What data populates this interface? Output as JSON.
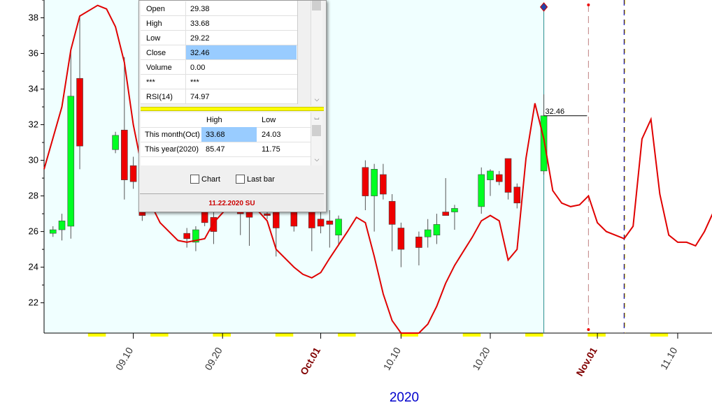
{
  "chart_data": {
    "type": "candlestick",
    "year_label": "2020",
    "y_ticks": [
      "22",
      "24",
      "26",
      "28",
      "30",
      "32",
      "34",
      "36",
      "38"
    ],
    "x_tick_labels": [
      {
        "text": "09.10",
        "emph": false
      },
      {
        "text": "09.20",
        "emph": false
      },
      {
        "text": "Oct.01",
        "emph": true
      },
      {
        "text": "10.10",
        "emph": false
      },
      {
        "text": "10.20",
        "emph": false
      },
      {
        "text": "Nov.01",
        "emph": true
      },
      {
        "text": "11.10",
        "emph": false
      }
    ],
    "last_price_label": "32.46",
    "ylim": [
      20.3,
      39.0
    ],
    "candles": [
      {
        "date": "2020-09-01",
        "open": 25.9,
        "high": 26.3,
        "low": 25.7,
        "close": 26.1
      },
      {
        "date": "2020-09-02",
        "open": 26.1,
        "high": 27.0,
        "low": 25.5,
        "close": 26.6
      },
      {
        "date": "2020-09-03",
        "open": 26.3,
        "high": 36.2,
        "low": 25.6,
        "close": 33.6
      },
      {
        "date": "2020-09-04",
        "open": 34.6,
        "high": 38.0,
        "low": 29.5,
        "close": 30.8
      },
      {
        "date": "2020-09-08",
        "open": 30.6,
        "high": 31.6,
        "low": 30.4,
        "close": 31.4
      },
      {
        "date": "2020-09-09",
        "open": 31.7,
        "high": 35.8,
        "low": 27.8,
        "close": 28.9
      },
      {
        "date": "2020-09-10",
        "open": 29.7,
        "high": 30.2,
        "low": 28.4,
        "close": 28.8
      },
      {
        "date": "2020-09-11",
        "open": 28.6,
        "high": 29.5,
        "low": 26.6,
        "close": 26.9
      },
      {
        "date": "2020-09-16",
        "open": 25.9,
        "high": 26.2,
        "low": 25.1,
        "close": 25.6
      },
      {
        "date": "2020-09-17",
        "open": 25.4,
        "high": 26.3,
        "low": 24.9,
        "close": 26.1
      },
      {
        "date": "2020-09-18",
        "open": 27.2,
        "high": 27.8,
        "low": 26.3,
        "close": 26.5
      },
      {
        "date": "2020-09-19",
        "open": 26.8,
        "high": 27.1,
        "low": 25.3,
        "close": 26.0
      },
      {
        "date": "2020-09-22",
        "open": 28.3,
        "high": 29.2,
        "low": 25.8,
        "close": 27.0
      },
      {
        "date": "2020-09-23",
        "open": 27.3,
        "high": 27.8,
        "low": 25.2,
        "close": 26.8
      },
      {
        "date": "2020-09-25",
        "open": 27.0,
        "high": 27.5,
        "low": 26.7,
        "close": 26.9
      },
      {
        "date": "2020-09-26",
        "open": 28.0,
        "high": 28.6,
        "low": 24.6,
        "close": 26.2
      },
      {
        "date": "2020-09-28",
        "open": 27.2,
        "high": 27.9,
        "low": 26.0,
        "close": 26.3
      },
      {
        "date": "2020-09-30",
        "open": 27.3,
        "high": 28.3,
        "low": 24.9,
        "close": 26.2
      },
      {
        "date": "2020-10-01",
        "open": 26.7,
        "high": 28.0,
        "low": 25.9,
        "close": 26.3
      },
      {
        "date": "2020-10-02",
        "open": 26.6,
        "high": 27.2,
        "low": 25.1,
        "close": 26.4
      },
      {
        "date": "2020-10-03",
        "open": 25.8,
        "high": 26.9,
        "low": 25.2,
        "close": 26.7
      },
      {
        "date": "2020-10-06",
        "open": 29.6,
        "high": 30.0,
        "low": 27.2,
        "close": 28.0
      },
      {
        "date": "2020-10-07",
        "open": 28.0,
        "high": 29.8,
        "low": 26.0,
        "close": 29.5
      },
      {
        "date": "2020-10-08",
        "open": 29.2,
        "high": 29.8,
        "low": 27.8,
        "close": 28.1
      },
      {
        "date": "2020-10-09",
        "open": 27.7,
        "high": 28.1,
        "low": 24.9,
        "close": 26.4
      },
      {
        "date": "2020-10-10",
        "open": 26.2,
        "high": 26.5,
        "low": 24.0,
        "close": 25.0
      },
      {
        "date": "2020-10-12",
        "open": 25.7,
        "high": 26.0,
        "low": 24.1,
        "close": 25.1
      },
      {
        "date": "2020-10-13",
        "open": 25.7,
        "high": 26.7,
        "low": 25.1,
        "close": 26.1
      },
      {
        "date": "2020-10-14",
        "open": 25.8,
        "high": 27.0,
        "low": 25.3,
        "close": 26.4
      },
      {
        "date": "2020-10-15",
        "open": 27.1,
        "high": 29.0,
        "low": 26.9,
        "close": 26.9
      },
      {
        "date": "2020-10-16",
        "open": 27.1,
        "high": 27.5,
        "low": 26.1,
        "close": 27.3
      },
      {
        "date": "2020-10-19",
        "open": 27.4,
        "high": 29.6,
        "low": 27.0,
        "close": 29.2
      },
      {
        "date": "2020-10-20",
        "open": 28.9,
        "high": 29.5,
        "low": 28.0,
        "close": 29.4
      },
      {
        "date": "2020-10-21",
        "open": 29.2,
        "high": 29.4,
        "low": 28.6,
        "close": 28.8
      },
      {
        "date": "2020-10-22",
        "open": 30.1,
        "high": 30.1,
        "low": 27.8,
        "close": 28.2
      },
      {
        "date": "2020-10-23",
        "open": 28.5,
        "high": 28.7,
        "low": 27.3,
        "close": 27.6
      },
      {
        "date": "2020-10-26",
        "open": 29.4,
        "high": 33.7,
        "low": 29.2,
        "close": 32.5
      }
    ],
    "rsi_line": [
      {
        "date": "2020-08-31",
        "value": 29.5
      },
      {
        "date": "2020-09-02",
        "value": 33.0
      },
      {
        "date": "2020-09-03",
        "value": 36.2
      },
      {
        "date": "2020-09-04",
        "value": 38.1
      },
      {
        "date": "2020-09-06",
        "value": 38.7
      },
      {
        "date": "2020-09-07",
        "value": 38.5
      },
      {
        "date": "2020-09-08",
        "value": 37.5
      },
      {
        "date": "2020-09-09",
        "value": 35.5
      },
      {
        "date": "2020-09-10",
        "value": 32.0
      },
      {
        "date": "2020-09-11",
        "value": 29.5
      },
      {
        "date": "2020-09-12",
        "value": 27.5
      },
      {
        "date": "2020-09-13",
        "value": 26.5
      },
      {
        "date": "2020-09-15",
        "value": 25.5
      },
      {
        "date": "2020-09-16",
        "value": 25.4
      },
      {
        "date": "2020-09-18",
        "value": 25.6
      },
      {
        "date": "2020-09-19",
        "value": 26.5
      },
      {
        "date": "2020-09-21",
        "value": 27.6
      },
      {
        "date": "2020-09-23",
        "value": 27.7
      },
      {
        "date": "2020-09-25",
        "value": 26.6
      },
      {
        "date": "2020-09-26",
        "value": 25.0
      },
      {
        "date": "2020-09-28",
        "value": 24.0
      },
      {
        "date": "2020-09-29",
        "value": 23.6
      },
      {
        "date": "2020-09-30",
        "value": 23.4
      },
      {
        "date": "2020-10-01",
        "value": 23.7
      },
      {
        "date": "2020-10-02",
        "value": 24.5
      },
      {
        "date": "2020-10-04",
        "value": 26.0
      },
      {
        "date": "2020-10-05",
        "value": 26.8
      },
      {
        "date": "2020-10-06",
        "value": 26.5
      },
      {
        "date": "2020-10-07",
        "value": 24.6
      },
      {
        "date": "2020-10-08",
        "value": 22.5
      },
      {
        "date": "2020-10-09",
        "value": 21.0
      },
      {
        "date": "2020-10-10",
        "value": 20.3
      },
      {
        "date": "2020-10-11",
        "value": 20.3
      },
      {
        "date": "2020-10-12",
        "value": 20.3
      },
      {
        "date": "2020-10-13",
        "value": 20.8
      },
      {
        "date": "2020-10-14",
        "value": 21.8
      },
      {
        "date": "2020-10-15",
        "value": 23.1
      },
      {
        "date": "2020-10-16",
        "value": 24.1
      },
      {
        "date": "2020-10-17",
        "value": 24.9
      },
      {
        "date": "2020-10-18",
        "value": 25.7
      },
      {
        "date": "2020-10-19",
        "value": 26.6
      },
      {
        "date": "2020-10-20",
        "value": 26.9
      },
      {
        "date": "2020-10-21",
        "value": 26.6
      },
      {
        "date": "2020-10-22",
        "value": 24.4
      },
      {
        "date": "2020-10-23",
        "value": 25.0
      },
      {
        "date": "2020-10-24",
        "value": 30.1
      },
      {
        "date": "2020-10-25",
        "value": 33.2
      },
      {
        "date": "2020-10-26",
        "value": 31.2
      },
      {
        "date": "2020-10-27",
        "value": 28.3
      },
      {
        "date": "2020-10-28",
        "value": 27.6
      },
      {
        "date": "2020-10-29",
        "value": 27.4
      },
      {
        "date": "2020-10-30",
        "value": 27.5
      },
      {
        "date": "2020-10-31",
        "value": 28.0
      },
      {
        "date": "2020-11-01",
        "value": 26.5
      },
      {
        "date": "2020-11-02",
        "value": 26.0
      },
      {
        "date": "2020-11-04",
        "value": 25.6
      },
      {
        "date": "2020-11-05",
        "value": 26.3
      },
      {
        "date": "2020-11-06",
        "value": 31.2
      },
      {
        "date": "2020-11-07",
        "value": 32.3
      },
      {
        "date": "2020-11-08",
        "value": 28.1
      },
      {
        "date": "2020-11-09",
        "value": 25.8
      },
      {
        "date": "2020-11-10",
        "value": 25.4
      },
      {
        "date": "2020-11-11",
        "value": 25.4
      },
      {
        "date": "2020-11-12",
        "value": 25.2
      },
      {
        "date": "2020-11-13",
        "value": 26.0
      },
      {
        "date": "2020-11-14",
        "value": 27.1
      },
      {
        "date": "2020-11-16",
        "value": 28.0
      }
    ],
    "today_line_date": "2020-10-26",
    "dashed_line_date": "2020-10-31",
    "blue_dashed_line_date": "2020-11-04",
    "colors": {
      "background_shade": "#f0ffff",
      "up": "#00ff22",
      "down": "#ee0000",
      "line": "#e00000",
      "axis": "#000000",
      "year": "#0000cc",
      "emph_date": "#800000",
      "weekend_mark": "#ffff00"
    }
  },
  "data_window": {
    "ohlc": [
      {
        "label": "Open",
        "value": "29.38"
      },
      {
        "label": "High",
        "value": "33.68"
      },
      {
        "label": "Low",
        "value": "29.22"
      },
      {
        "label": "Close",
        "value": "32.46"
      },
      {
        "label": "Volume",
        "value": "0.00"
      },
      {
        "label": "***",
        "value": "***"
      },
      {
        "label": "RSI(14)",
        "value": "74.97"
      }
    ],
    "range_header": {
      "high": "High",
      "low": "Low"
    },
    "range_rows": [
      {
        "label": "This month(Oct)",
        "high": "33.68",
        "low": "24.03"
      },
      {
        "label": "This year(2020)",
        "high": "85.47",
        "low": "11.75"
      }
    ],
    "checkbox_chart": "Chart",
    "checkbox_last_bar": "Last bar",
    "status": "11.22.2020 SU"
  }
}
